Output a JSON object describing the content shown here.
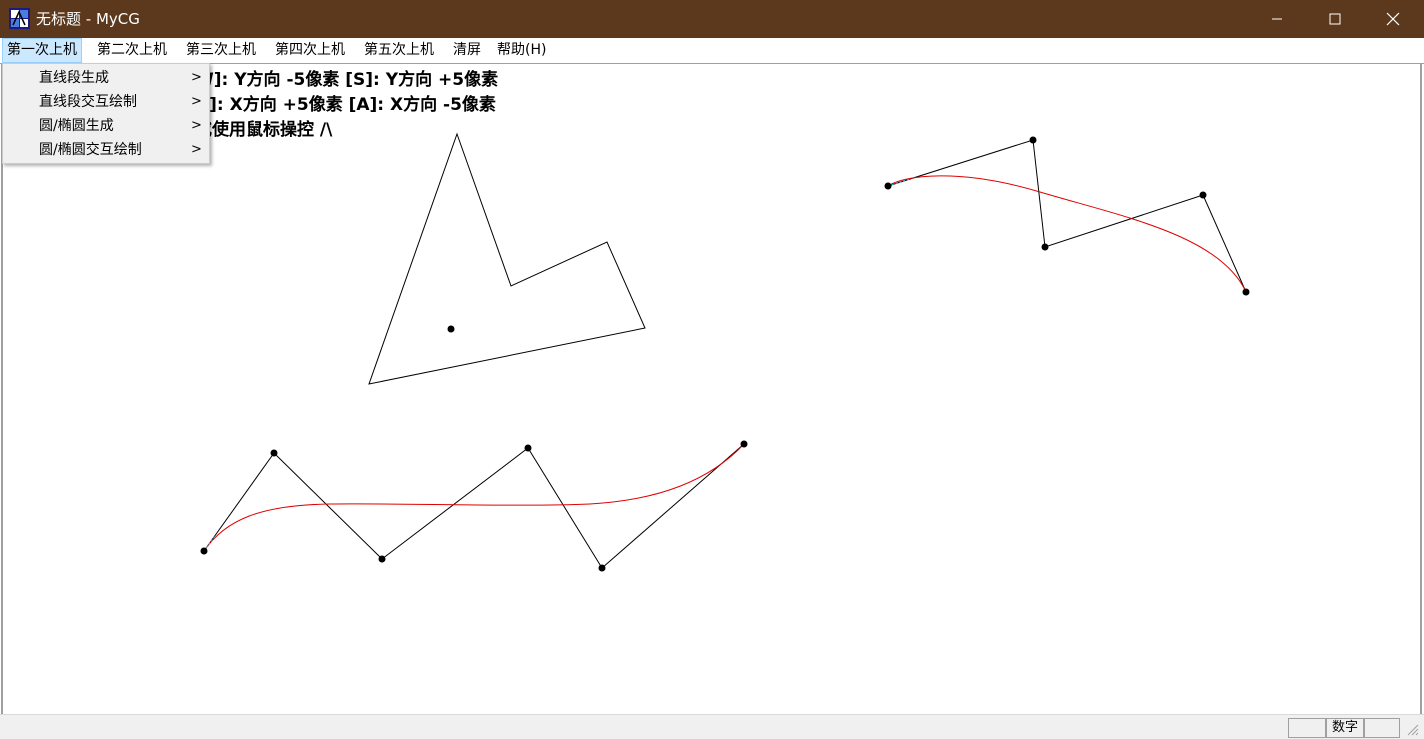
{
  "window": {
    "title": "无标题 - MyCG",
    "icon": "app-icon",
    "controls": {
      "minimize_icon": "minimize-icon",
      "maximize_icon": "maximize-icon",
      "close_icon": "close-icon"
    }
  },
  "menubar": {
    "items": [
      {
        "label": "第一次上机"
      },
      {
        "label": "第二次上机"
      },
      {
        "label": "第三次上机"
      },
      {
        "label": "第四次上机"
      },
      {
        "label": "第五次上机"
      },
      {
        "label": "清屏"
      },
      {
        "label": "帮助(H)"
      }
    ]
  },
  "dropdown": {
    "items": [
      {
        "label": "直线段生成",
        "arrow": ">"
      },
      {
        "label": "直线段交互绘制",
        "arrow": ">"
      },
      {
        "label": "圆/椭圆生成",
        "arrow": ">"
      },
      {
        "label": "圆/椭圆交互绘制",
        "arrow": ">"
      }
    ]
  },
  "canvas_text": {
    "line1": "W]: Y方向 -5像素  [S]: Y方向 +5像素",
    "line2": "D]: X方向 +5像素  [A]: X方向 -5像素",
    "line3": "或使用鼠标操控  /\\"
  },
  "statusbar": {
    "numlock": "数字"
  },
  "colors": {
    "titlebar": "#5c391c",
    "curve": "#e00000",
    "polygon": "#000000",
    "menu_highlight": "#cce8ff"
  }
}
